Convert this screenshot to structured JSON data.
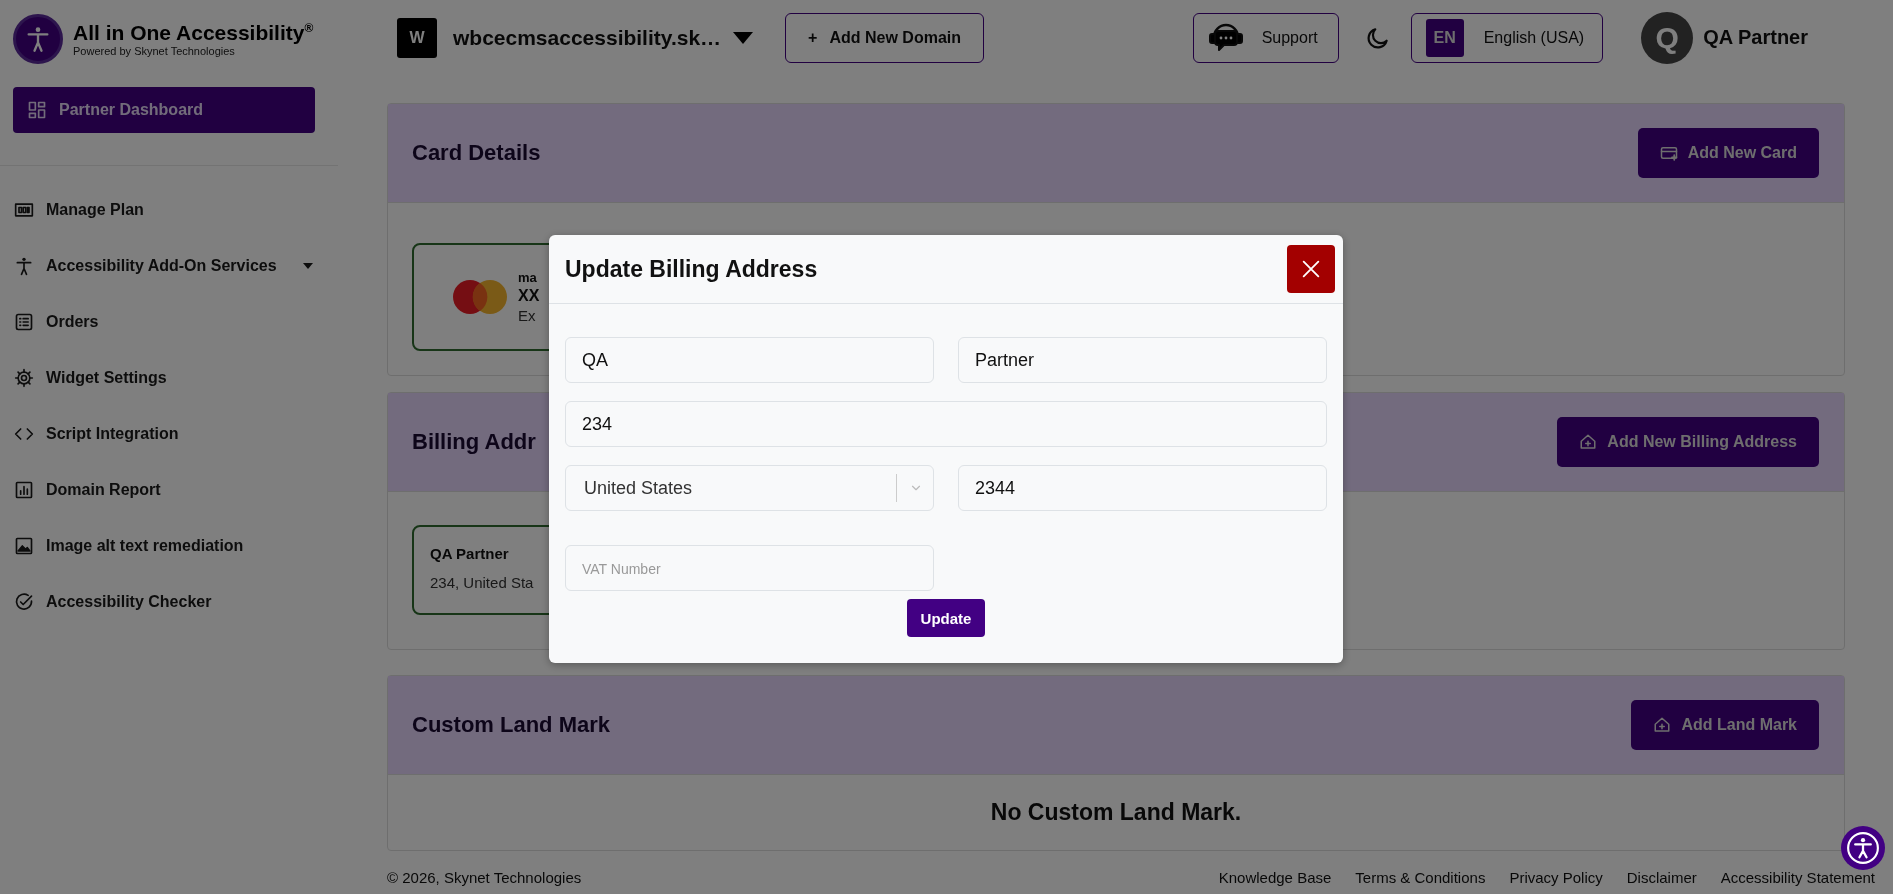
{
  "brand": {
    "title": "All in One Accessibility$^{®}$",
    "subtitle": "Powered by Skynet Technologies"
  },
  "topbar": {
    "domain_initial": "W",
    "domain": "wbcecmsaccessibility.sk…",
    "add_domain": {
      "icon": "+",
      "label": "Add New Domain"
    },
    "support": "Support",
    "language": {
      "code": "EN",
      "name": "English (USA)"
    },
    "user": {
      "initial": "Q",
      "name": "QA Partner"
    }
  },
  "sidebar": {
    "items": [
      {
        "label": "Partner Dashboard",
        "kind": "primary",
        "selected": true
      },
      {
        "label": "Manage Plan",
        "kind": "link",
        "selected": false
      },
      {
        "label": "Accessibility Add-On Services",
        "kind": "submenu",
        "selected": false
      },
      {
        "label": "Orders",
        "kind": "link",
        "selected": false
      },
      {
        "label": "Widget Settings",
        "kind": "link",
        "selected": false
      },
      {
        "label": "Script Integration",
        "kind": "link",
        "selected": false
      },
      {
        "label": "Domain Report",
        "kind": "link",
        "selected": false
      },
      {
        "label": "Image alt text remediation",
        "kind": "link",
        "selected": false
      },
      {
        "label": "Accessibility Checker",
        "kind": "link",
        "selected": false
      }
    ]
  },
  "sections": [
    {
      "title": "Card Details",
      "action": "Add New Card",
      "kind": "card",
      "card": {
        "brand": "ma",
        "number": "XX",
        "expiry": "Ex"
      }
    },
    {
      "title": "Billing Addr",
      "action": "Add New Billing Address",
      "kind": "address",
      "address": {
        "name": "QA Partner",
        "line": "234, United Sta"
      }
    },
    {
      "title": "Custom Land Mark",
      "action": "Add Land Mark",
      "kind": "empty",
      "message": "No Custom Land Mark."
    }
  ],
  "modal": {
    "title": "Update Billing Address",
    "fields": [
      {
        "kind": "text",
        "value": "QA"
      },
      {
        "kind": "text",
        "value": "Partner"
      },
      {
        "kind": "text",
        "value": "234"
      },
      {
        "kind": "select",
        "value": "United States"
      },
      {
        "kind": "text",
        "value": "2344"
      },
      {
        "kind": "text",
        "placeholder": "VAT Number"
      }
    ],
    "button": "Update"
  },
  "footer": {
    "copyright": "© 2026, Skynet Technologies",
    "links": [
      "Knowledge Base",
      "Terms & Conditions",
      "Privacy Policy",
      "Disclaimer",
      "Accessibility Statement"
    ]
  }
}
